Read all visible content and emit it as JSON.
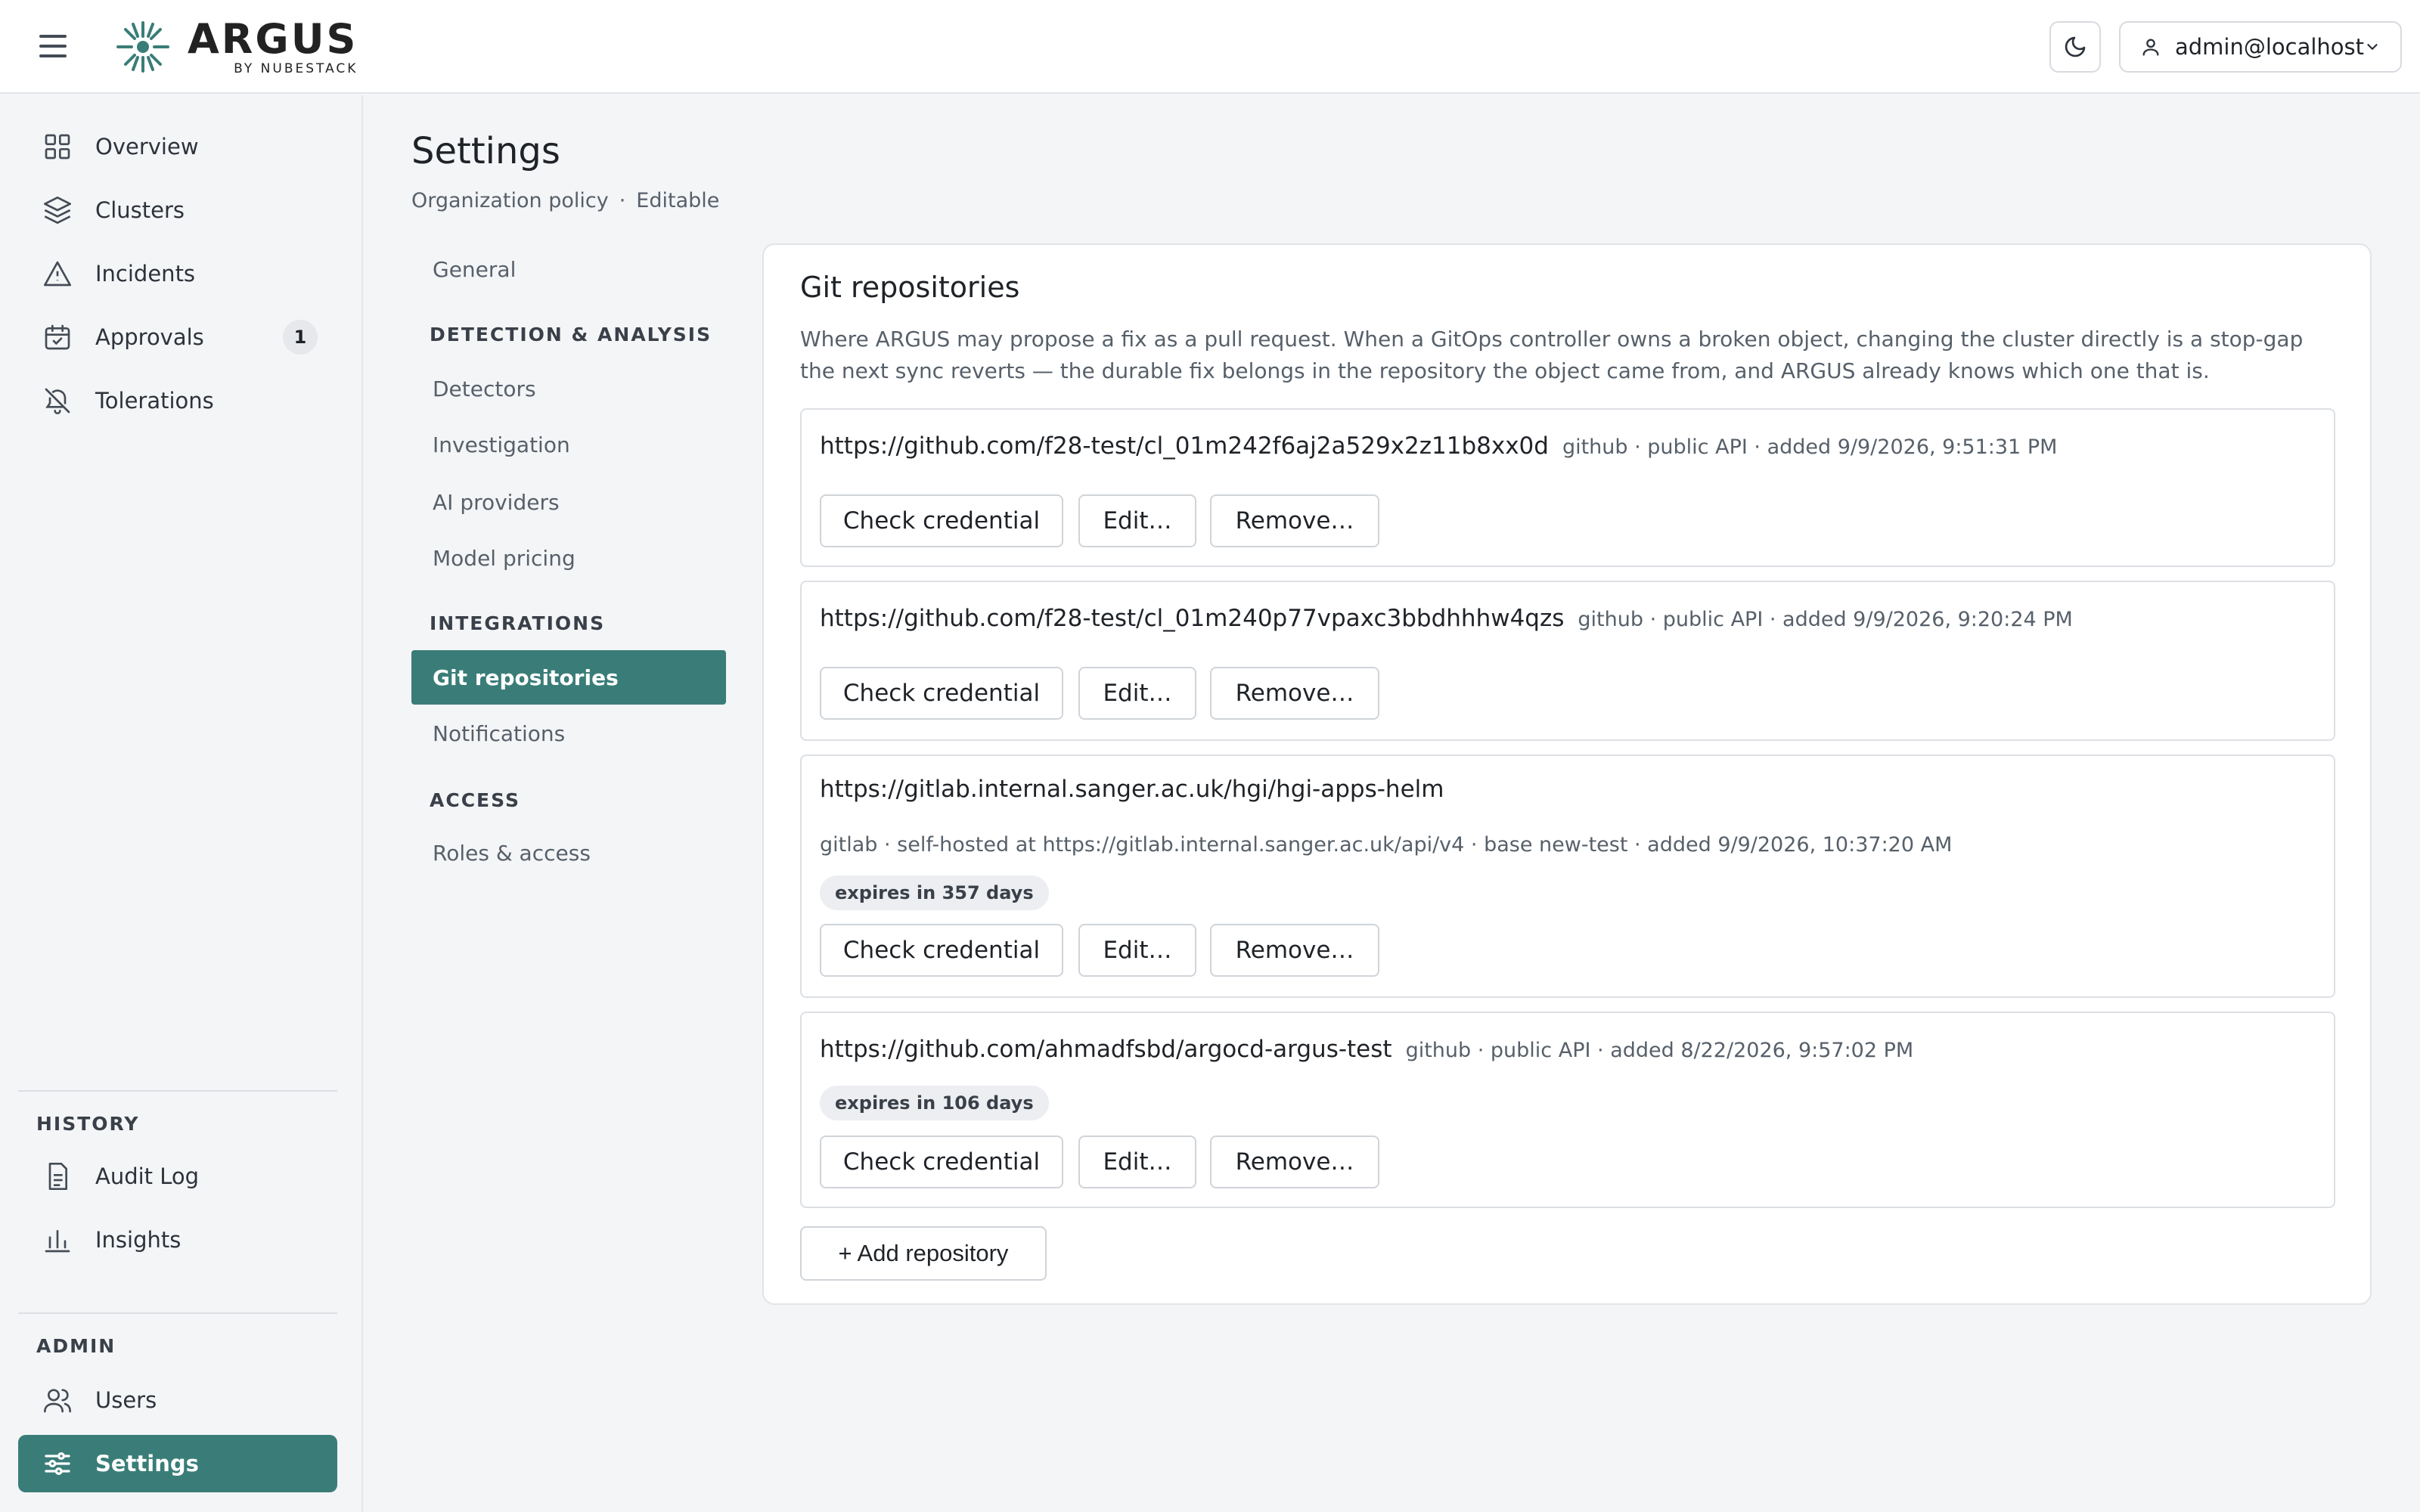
{
  "app": {
    "name": "ARGUS",
    "byline": "BY NUBESTACK",
    "user": "admin@localhost"
  },
  "sidebar": {
    "main": [
      {
        "label": "Overview",
        "icon": "grid-icon"
      },
      {
        "label": "Clusters",
        "icon": "layers-icon"
      },
      {
        "label": "Incidents",
        "icon": "warning-icon"
      },
      {
        "label": "Approvals",
        "icon": "calendar-check-icon",
        "badge": "1"
      },
      {
        "label": "Tolerations",
        "icon": "bell-off-icon"
      }
    ],
    "history_title": "HISTORY",
    "history": [
      {
        "label": "Audit Log",
        "icon": "document-icon"
      },
      {
        "label": "Insights",
        "icon": "bar-chart-icon"
      }
    ],
    "admin_title": "ADMIN",
    "admin": [
      {
        "label": "Users",
        "icon": "users-icon"
      },
      {
        "label": "Settings",
        "icon": "sliders-icon"
      }
    ]
  },
  "page": {
    "title": "Settings",
    "subtitle_left": "Organization policy",
    "subtitle_sep": "·",
    "subtitle_right": "Editable"
  },
  "subnav": {
    "general": "General",
    "section_detection": "DETECTION & ANALYSIS",
    "detectors": "Detectors",
    "investigation": "Investigation",
    "ai_providers": "AI providers",
    "model_pricing": "Model pricing",
    "section_integrations": "INTEGRATIONS",
    "git_repositories": "Git repositories",
    "notifications": "Notifications",
    "section_access": "ACCESS",
    "roles_access": "Roles & access"
  },
  "panel": {
    "title": "Git repositories",
    "description": "Where ARGUS may propose a fix as a pull request. When a GitOps controller owns a broken object, changing the cluster directly is a stop-gap the next sync reverts — the durable fix belongs in the repository the object came from, and ARGUS already knows which one that is.",
    "check_label": "Check credential",
    "edit_label": "Edit…",
    "remove_label": "Remove…",
    "add_label": "+ Add repository",
    "repos": [
      {
        "url": "https://github.com/f28-test/cl_01m242f6aj2a529x2z11b8xx0d",
        "meta": "github · public API · added 9/9/2026, 9:51:31 PM"
      },
      {
        "url": "https://github.com/f28-test/cl_01m240p77vpaxc3bbdhhhw4qzs",
        "meta": "github · public API · added 9/9/2026, 9:20:24 PM"
      },
      {
        "url": "https://gitlab.internal.sanger.ac.uk/hgi/hgi-apps-helm",
        "meta": "gitlab · self-hosted at https://gitlab.internal.sanger.ac.uk/api/v4 · base new-test · added 9/9/2026, 10:37:20 AM",
        "expires": "expires in 357 days"
      },
      {
        "url": "https://github.com/ahmadfsbd/argocd-argus-test",
        "meta": "github · public API · added 8/22/2026, 9:57:02 PM",
        "expires": "expires in 106 days"
      }
    ]
  },
  "colors": {
    "accent": "#3a7d78",
    "background": "#f4f5f7"
  }
}
